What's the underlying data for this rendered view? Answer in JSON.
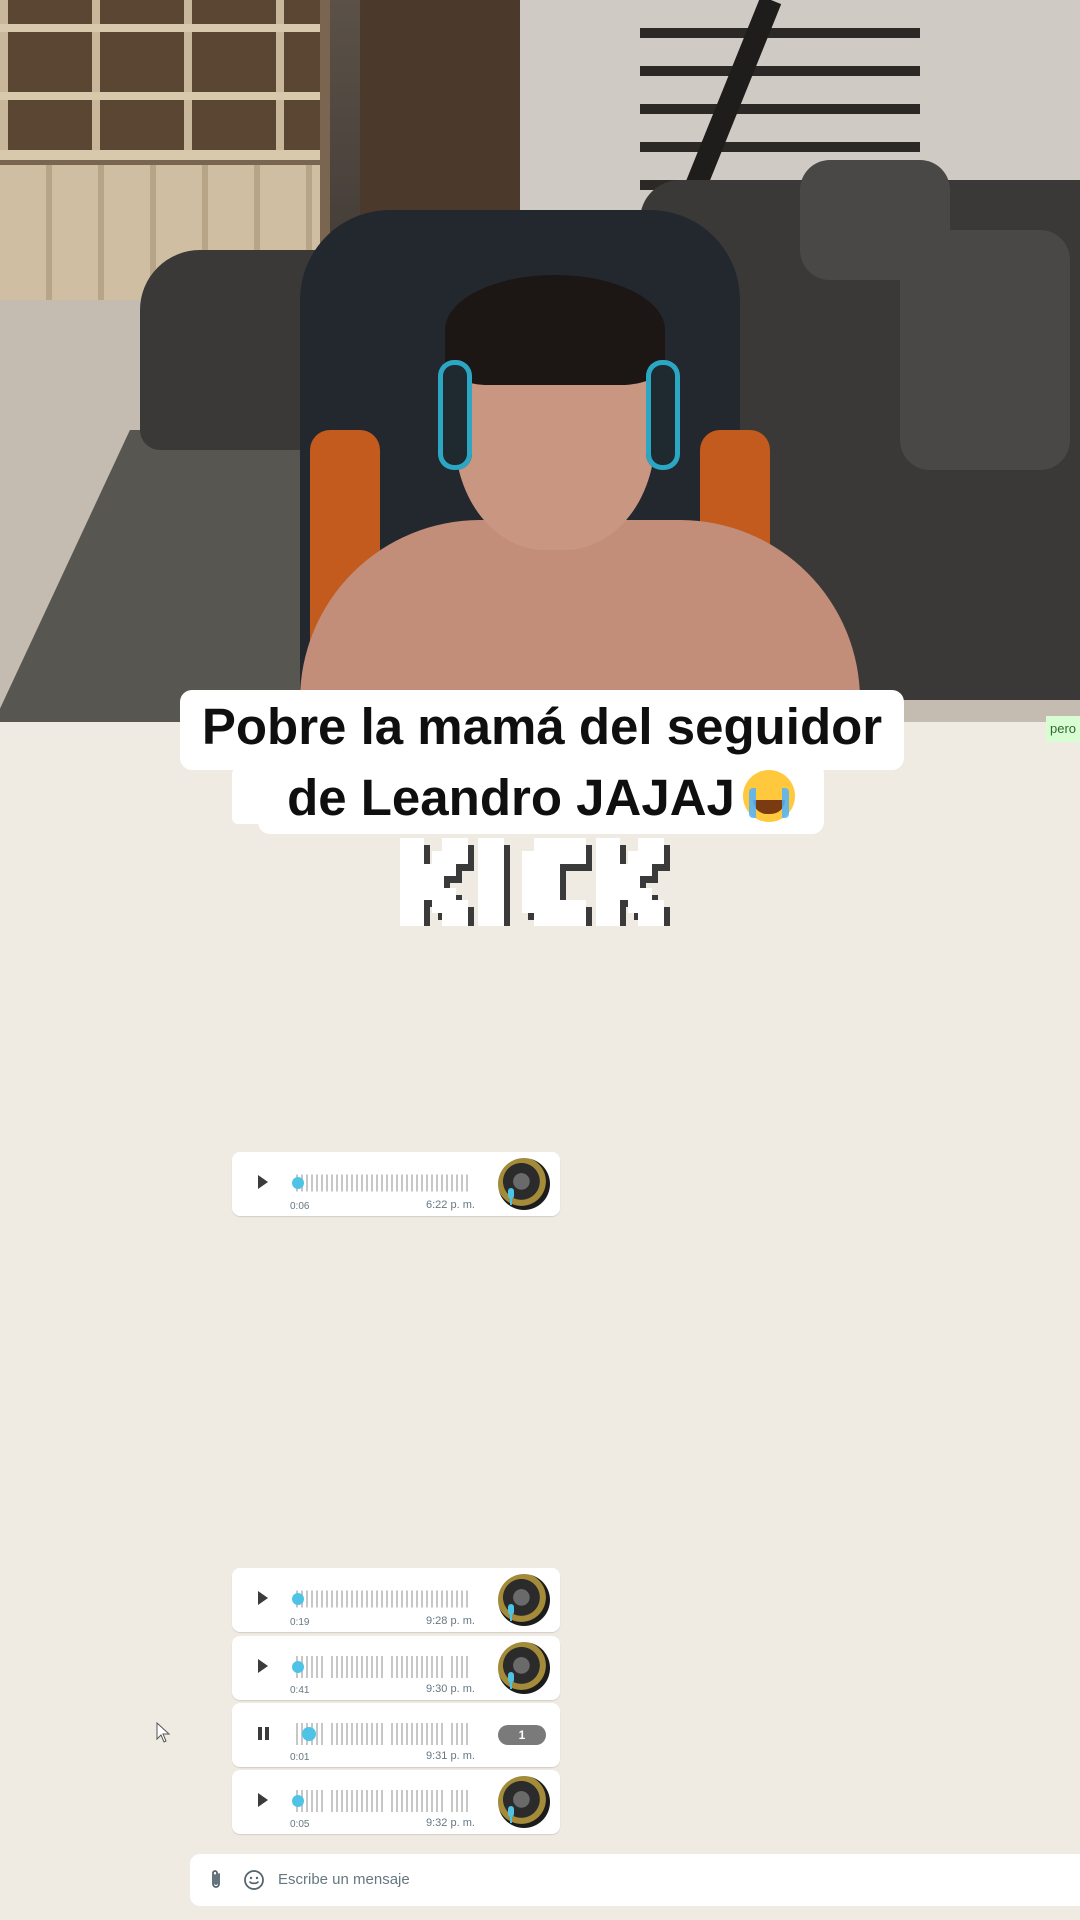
{
  "caption": {
    "line1": "Pobre la mamá del seguidor",
    "line2": "de Leandro JAJAJ",
    "emoji": "crying-face"
  },
  "logo": {
    "text": "KICK"
  },
  "peek_message": "pero",
  "voice_messages": [
    {
      "duration": "0:06",
      "time": "6:22 p. m.",
      "state": "paused",
      "sender_avatar": true
    },
    {
      "duration": "0:19",
      "time": "9:28 p. m.",
      "state": "paused",
      "sender_avatar": true
    },
    {
      "duration": "0:41",
      "time": "9:30 p. m.",
      "state": "paused",
      "sender_avatar": true
    },
    {
      "duration": "0:01",
      "time": "9:31 p. m.",
      "state": "playing",
      "playback_speed": "1"
    },
    {
      "duration": "0:05",
      "time": "9:32 p. m.",
      "state": "paused",
      "sender_avatar": true
    }
  ],
  "composer": {
    "placeholder": "Escribe un mensaje"
  },
  "colors": {
    "chat_background": "#efeae2",
    "bubble": "#ffffff",
    "accent": "#4fc3e6",
    "outgoing_bubble": "#d9fdd3"
  },
  "icons": [
    "play-icon",
    "pause-icon",
    "mic-icon",
    "attach-icon",
    "sticker-icon",
    "cursor-icon"
  ]
}
